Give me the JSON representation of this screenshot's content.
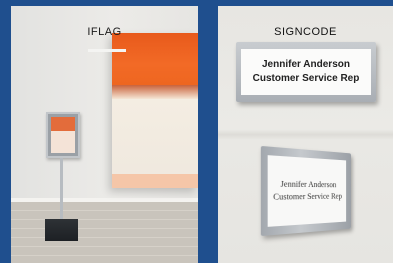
{
  "panels": {
    "left": {
      "title": "IFLAG"
    },
    "right": {
      "title": "SIGNCODE",
      "sign_front": {
        "name": "Jennifer Anderson",
        "role": "Customer Service Rep"
      },
      "sign_angled": {
        "name": "Jennifer Anderson",
        "role": "Customer Service Rep"
      }
    }
  },
  "colors": {
    "background": "#1f4f8e",
    "painting_orange": "#f26a26"
  }
}
